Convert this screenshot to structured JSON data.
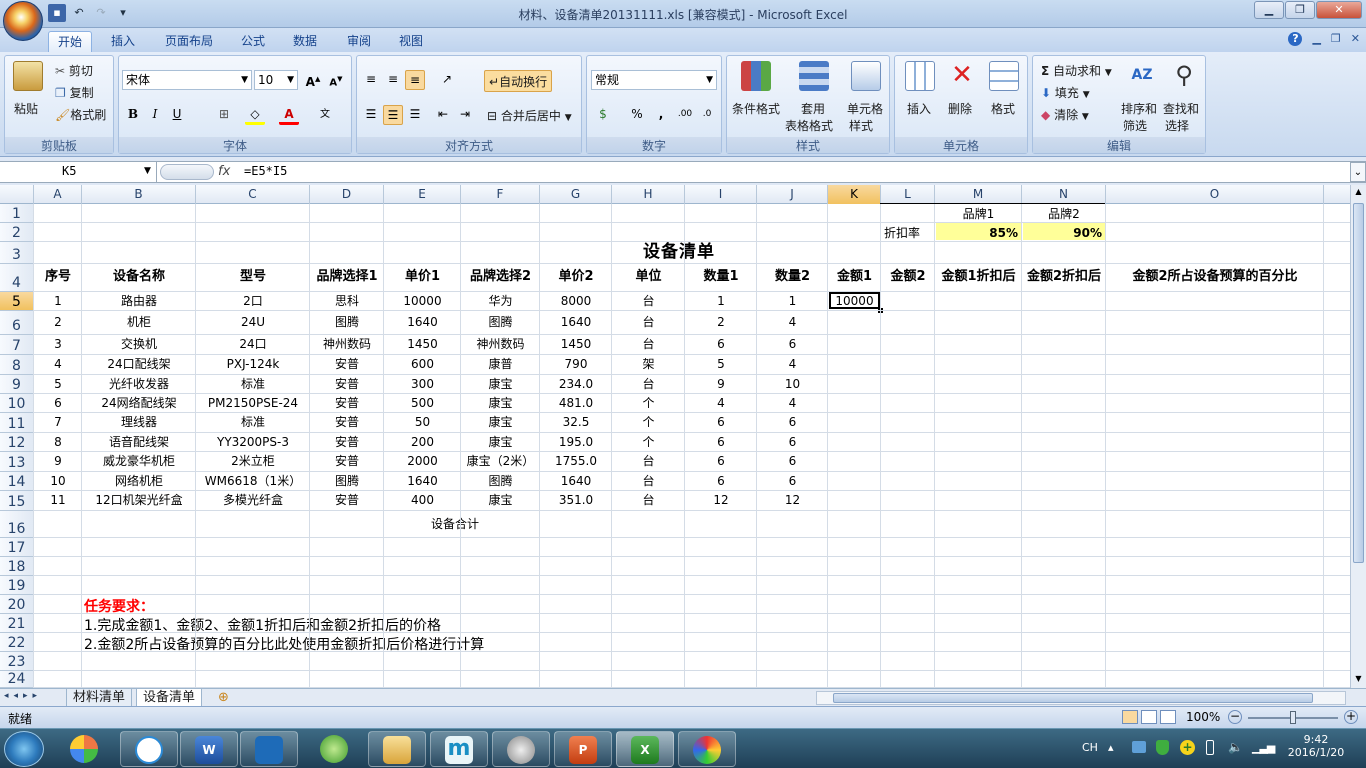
{
  "window": {
    "title": "材料、设备清单20131111.xls  [兼容模式] - Microsoft Excel"
  },
  "ribbon_tabs": [
    "开始",
    "插入",
    "页面布局",
    "公式",
    "数据",
    "审阅",
    "视图"
  ],
  "ribbon": {
    "clipboard": {
      "paste": "粘贴",
      "cut": "剪切",
      "copy": "复制",
      "format_painter": "格式刷",
      "title": "剪贴板"
    },
    "font": {
      "name": "宋体",
      "size": "10",
      "title": "字体"
    },
    "alignment": {
      "wrap": "自动换行",
      "merge": "合并后居中",
      "title": "对齐方式"
    },
    "number": {
      "format": "常规",
      "title": "数字"
    },
    "styles": {
      "conditional": "条件格式",
      "table_l1": "套用",
      "table_l2": "表格格式",
      "cell_l1": "单元格",
      "cell_l2": "样式",
      "title": "样式"
    },
    "cells": {
      "insert": "插入",
      "delete": "删除",
      "format": "格式",
      "title": "单元格"
    },
    "editing": {
      "autosum": "自动求和",
      "fill": "填充",
      "clear": "清除",
      "sort_l1": "排序和",
      "sort_l2": "筛选",
      "find_l1": "查找和",
      "find_l2": "选择",
      "title": "编辑"
    }
  },
  "formula_bar": {
    "cell_ref": "K5",
    "fx": "fx",
    "formula": "=E5*I5"
  },
  "columns": [
    "A",
    "B",
    "C",
    "D",
    "E",
    "F",
    "G",
    "H",
    "I",
    "J",
    "K",
    "L",
    "M",
    "N",
    "O"
  ],
  "rows": [
    "1",
    "2",
    "3",
    "4",
    "5",
    "6",
    "7",
    "8",
    "9",
    "10",
    "11",
    "12",
    "13",
    "14",
    "15",
    "16",
    "17",
    "18",
    "19",
    "20",
    "21",
    "22",
    "23",
    "24"
  ],
  "sheet": {
    "brand1_label": "品牌1",
    "brand2_label": "品牌2",
    "discount_label": "折扣率",
    "discount1": "85%",
    "discount2": "90%",
    "title": "设备清单",
    "headers": [
      "序号",
      "设备名称",
      "型号",
      "品牌选择1",
      "单价1",
      "品牌选择2",
      "单价2",
      "单位",
      "数量1",
      "数量2",
      "金额1",
      "金额2",
      "金额1折扣后",
      "金额2折扣后",
      "金额2所占设备预算的百分比"
    ],
    "rows": [
      [
        "1",
        "路由器",
        "2口",
        "思科",
        "10000",
        "华为",
        "8000",
        "台",
        "1",
        "1",
        "10000"
      ],
      [
        "2",
        "机柜",
        "24U",
        "图腾",
        "1640",
        "图腾",
        "1640",
        "台",
        "2",
        "4",
        ""
      ],
      [
        "3",
        "交换机",
        "24口",
        "神州数码",
        "1450",
        "神州数码",
        "1450",
        "台",
        "6",
        "6",
        ""
      ],
      [
        "4",
        "24口配线架",
        "PXJ-124k",
        "安普",
        "600",
        "康普",
        "790",
        "架",
        "5",
        "4",
        ""
      ],
      [
        "5",
        "光纤收发器",
        "标准",
        "安普",
        "300",
        "康宝",
        "234.0",
        "台",
        "9",
        "10",
        ""
      ],
      [
        "6",
        "24网络配线架",
        "PM2150PSE-24",
        "安普",
        "500",
        "康宝",
        "481.0",
        "个",
        "4",
        "4",
        ""
      ],
      [
        "7",
        "理线器",
        "标准",
        "安普",
        "50",
        "康宝",
        "32.5",
        "个",
        "6",
        "6",
        ""
      ],
      [
        "8",
        "语音配线架",
        "YY3200PS-3",
        "安普",
        "200",
        "康宝",
        "195.0",
        "个",
        "6",
        "6",
        ""
      ],
      [
        "9",
        "威龙豪华机柜",
        "2米立柜",
        "安普",
        "2000",
        "康宝（2米）",
        "1755.0",
        "台",
        "6",
        "6",
        ""
      ],
      [
        "10",
        "网络机柜",
        "WM6618（1米）",
        "图腾",
        "1640",
        "图腾",
        "1640",
        "台",
        "6",
        "6",
        ""
      ],
      [
        "11",
        "12口机架光纤盒",
        "多模光纤盒",
        "安普",
        "400",
        "康宝",
        "351.0",
        "台",
        "12",
        "12",
        ""
      ]
    ],
    "total_label": "设备合计",
    "task_title": "任务要求：",
    "task1": "1.完成金额1、金额2、金额1折扣后和金额2折扣后的价格",
    "task2": "2.金额2所占设备预算的百分比此处使用金额折扣后价格进行计算"
  },
  "sheet_tabs": [
    "材料清单",
    "设备清单"
  ],
  "status": {
    "ready": "就绪",
    "zoom": "100%"
  },
  "taskbar": {
    "lang": "CH",
    "time": "9:42",
    "date": "2016/1/20"
  },
  "colors": {
    "accent": "#15428b",
    "selected_header": "#f1c15f",
    "discount_fill": "#ffff99",
    "task_red": "#ff0000"
  }
}
